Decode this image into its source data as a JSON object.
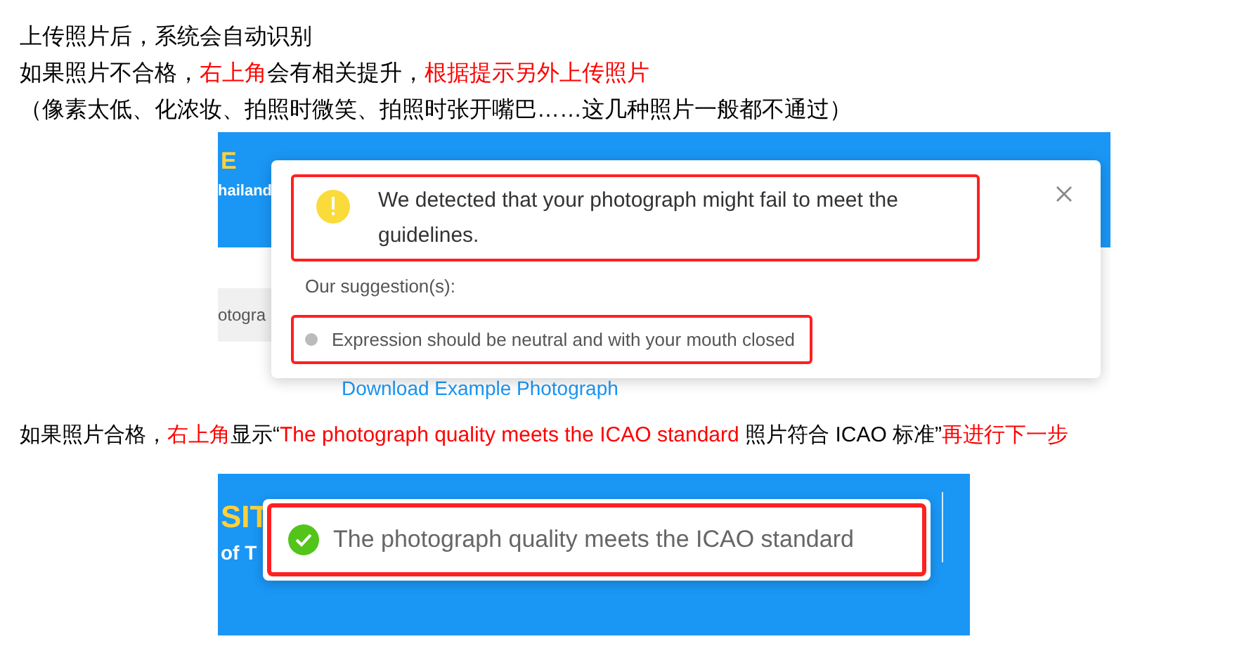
{
  "intro_lines": [
    {
      "segments": [
        {
          "text": "上传照片后，系统会自动识别",
          "emphasis": false
        }
      ]
    },
    {
      "segments": [
        {
          "text": "如果照片不合格，",
          "emphasis": false
        },
        {
          "text": "右上角",
          "emphasis": true
        },
        {
          "text": "会有相关提升，",
          "emphasis": false
        },
        {
          "text": "根据提示另外上传照片",
          "emphasis": true
        }
      ]
    },
    {
      "segments": [
        {
          "text": "（像素太低、化浓妆、拍照时微笑、拍照时张开嘴巴……这几种照片一般都不通过）",
          "emphasis": false
        }
      ]
    }
  ],
  "screenshot_fail": {
    "header_texts": [
      "E",
      "hailand"
    ],
    "field_fragment": "otogra",
    "download_link": "Download Example Photograph",
    "popup": {
      "title": "We detected that your photograph might fail to meet the guidelines.",
      "suggestions_label": "Our suggestion(s):",
      "suggestions": [
        "Expression should be neutral and with your mouth closed"
      ]
    }
  },
  "pass_line": {
    "segments": [
      {
        "text": "如果照片合格，",
        "emphasis": false
      },
      {
        "text": "右上角",
        "emphasis": true
      },
      {
        "text": "显示“",
        "emphasis": false
      },
      {
        "text": "The photograph quality meets the ICAO standard",
        "emphasis": true
      },
      {
        "text": " 照片符合 ICAO 标准”",
        "emphasis": false
      },
      {
        "text": "再进行下一步",
        "emphasis": true
      }
    ]
  },
  "screenshot_pass": {
    "header_texts": [
      "SIT",
      "of T"
    ],
    "toast": {
      "message": "The photograph quality meets the ICAO standard"
    }
  }
}
